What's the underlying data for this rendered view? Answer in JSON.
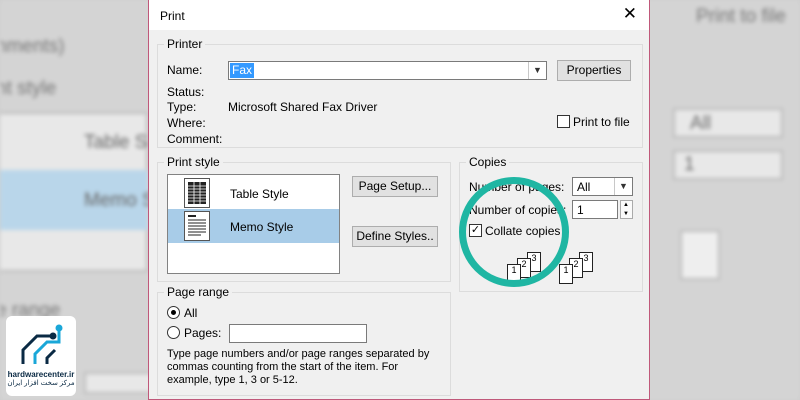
{
  "background": {
    "text_top": "nments)",
    "text_style": "nt style",
    "text_table": "Table S",
    "text_memo": "Memo S",
    "text_range": "e range",
    "text_print_to_file": "Print to file",
    "text_all": "All",
    "text_one": "1"
  },
  "logo": {
    "en": "hardwarecenter.ir",
    "fa": "مرکز سخت افزار ایران"
  },
  "dialog": {
    "title": "Print",
    "close": "✕"
  },
  "printer": {
    "legend": "Printer",
    "name_label": "Name:",
    "name_value": "Fax",
    "properties_button": "Properties",
    "status_label": "Status:",
    "status_value": "",
    "type_label": "Type:",
    "type_value": "Microsoft Shared Fax Driver",
    "where_label": "Where:",
    "where_value": "",
    "comment_label": "Comment:",
    "comment_value": "",
    "print_to_file_label": "Print to file",
    "print_to_file_checked": false
  },
  "print_style": {
    "legend": "Print style",
    "items": [
      {
        "label": "Table Style",
        "selected": false
      },
      {
        "label": "Memo Style",
        "selected": true
      }
    ],
    "page_setup_button": "Page Setup...",
    "define_styles_button": "Define Styles.."
  },
  "copies": {
    "legend": "Copies",
    "pages_label": "Number of pages:",
    "pages_value": "All",
    "copies_label": "Number of copies:",
    "copies_value": "1",
    "collate_label": "Collate copies",
    "collate_checked": true,
    "collate_pages": [
      "1",
      "2",
      "3"
    ]
  },
  "page_range": {
    "legend": "Page range",
    "all_label": "All",
    "pages_label": "Pages:",
    "pages_value": "",
    "help_line1": "Type page numbers and/or page ranges separated by",
    "help_line2": "commas counting from the start of the item.  For",
    "help_line3": "example, type 1, 3 or 5-12."
  },
  "colors": {
    "accent_ring": "#1fb6a3",
    "selection": "#a8cce8",
    "dialog_border": "#c0587a"
  }
}
